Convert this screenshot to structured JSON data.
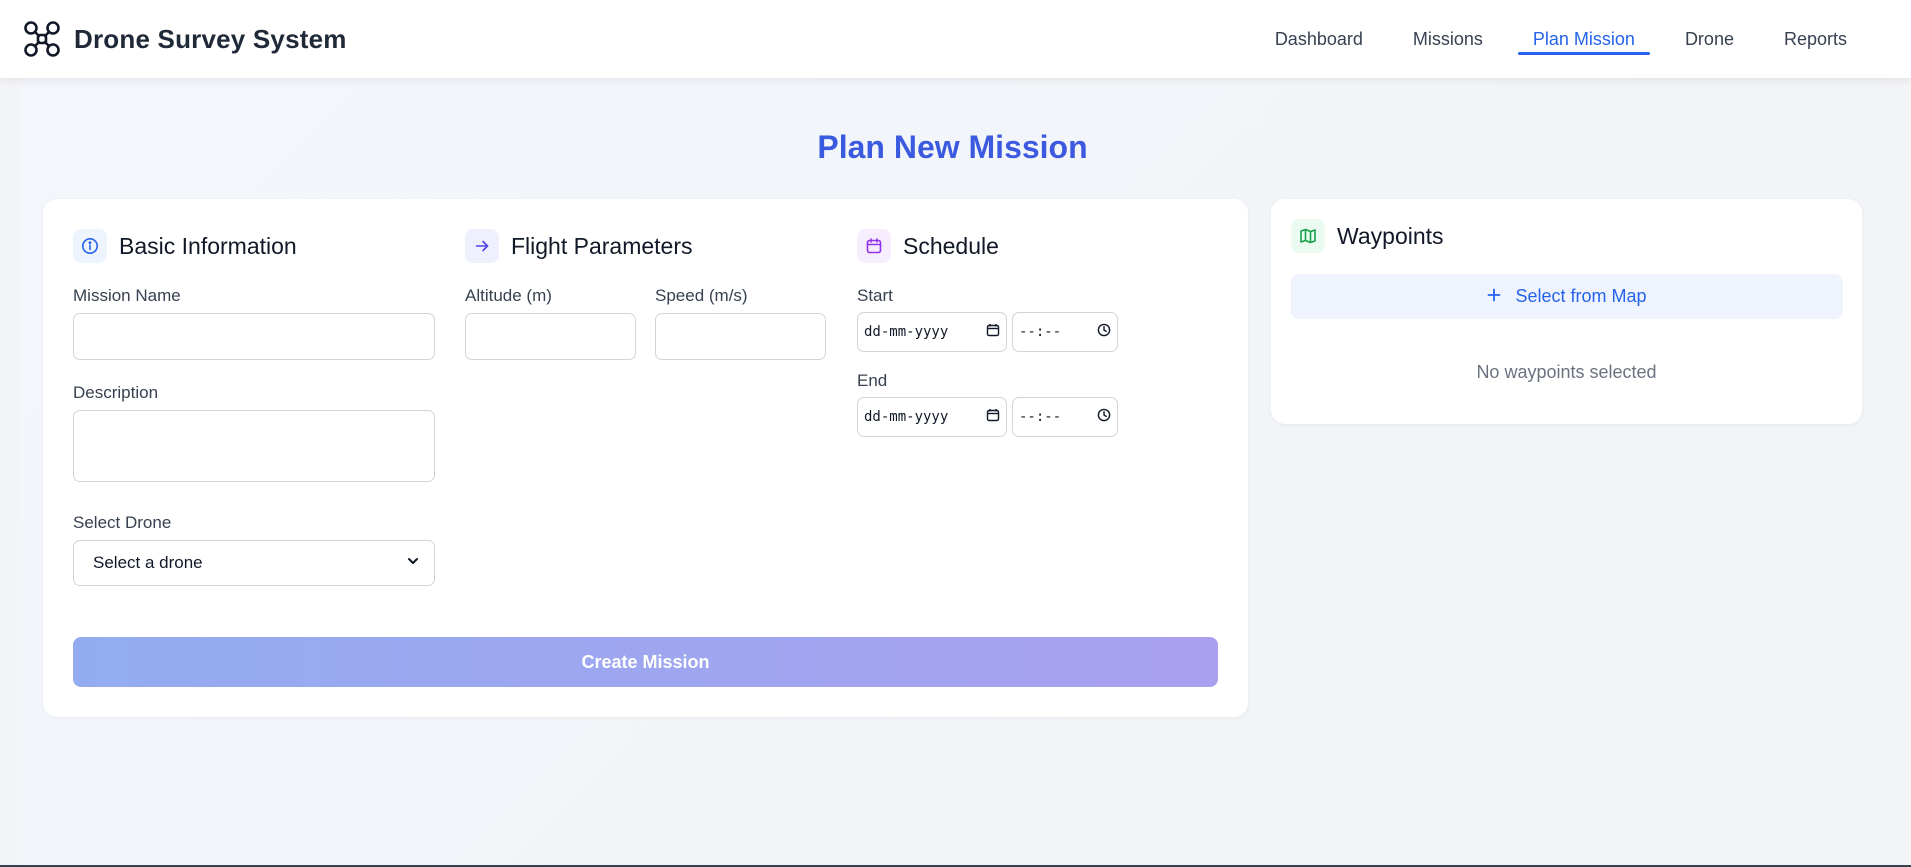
{
  "app": {
    "title": "Drone Survey System",
    "logo_icon": "drone-icon"
  },
  "nav": {
    "items": [
      {
        "label": "Dashboard",
        "active": false
      },
      {
        "label": "Missions",
        "active": false
      },
      {
        "label": "Plan Mission",
        "active": true
      },
      {
        "label": "Drone",
        "active": false
      },
      {
        "label": "Reports",
        "active": false
      }
    ]
  },
  "page": {
    "title": "Plan New Mission"
  },
  "basic_info": {
    "heading": "Basic Information",
    "icon": "info-icon",
    "mission_name_label": "Mission Name",
    "mission_name_value": "",
    "description_label": "Description",
    "description_value": "",
    "drone_label": "Select Drone",
    "drone_selected": "Select a drone"
  },
  "flight_params": {
    "heading": "Flight Parameters",
    "icon": "arrow-right-icon",
    "altitude_label": "Altitude (m)",
    "altitude_value": "",
    "speed_label": "Speed (m/s)",
    "speed_value": ""
  },
  "schedule": {
    "heading": "Schedule",
    "icon": "calendar-icon",
    "start_label": "Start",
    "start_date": "dd-mm-yyyy",
    "start_time": "--:--",
    "end_label": "End",
    "end_date": "dd-mm-yyyy",
    "end_time": "--:--"
  },
  "actions": {
    "create_label": "Create Mission"
  },
  "waypoints": {
    "heading": "Waypoints",
    "icon": "map-icon",
    "select_label": "Select from Map",
    "empty_text": "No waypoints selected"
  },
  "colors": {
    "accent": "#2563eb",
    "title": "#3b5bdb",
    "info_icon_bg": "#eef4fe",
    "flight_icon_bg": "#eef0fd",
    "schedule_icon_bg": "#f6eefe",
    "waypoint_icon_bg": "#ecfbf1"
  }
}
